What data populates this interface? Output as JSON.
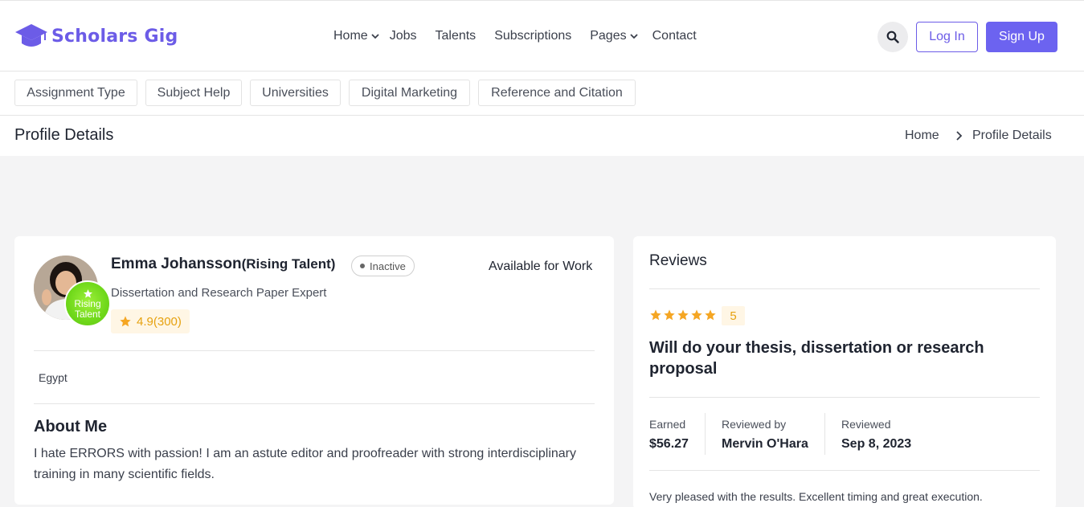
{
  "brand": {
    "name": "Scholars Gig",
    "color": "#6c5ce7"
  },
  "nav": {
    "items": [
      {
        "label": "Home",
        "dropdown": true
      },
      {
        "label": "Jobs",
        "dropdown": false
      },
      {
        "label": "Talents",
        "dropdown": false
      },
      {
        "label": "Subscriptions",
        "dropdown": false
      },
      {
        "label": "Pages",
        "dropdown": true
      },
      {
        "label": "Contact",
        "dropdown": false
      }
    ],
    "search_icon": "search-icon",
    "login_label": "Log In",
    "signup_label": "Sign Up"
  },
  "categories": [
    "Assignment Type",
    "Subject Help",
    "Universities",
    "Digital Marketing",
    "Reference and Citation"
  ],
  "page": {
    "title": "Profile Details",
    "breadcrumb": [
      "Home",
      "Profile Details"
    ]
  },
  "profile": {
    "name": "Emma Johansson",
    "name_suffix": "(Rising Talent)",
    "status": "Inactive",
    "availability": "Available for Work",
    "tagline": "Dissertation and Research Paper Expert",
    "rating": "4.9(300)",
    "badge_line1": "Rising",
    "badge_line2": "Talent",
    "location": "Egypt",
    "about_title": "About Me",
    "about_text": "I hate ERRORS with passion! I am an astute editor and proofreader with strong interdisciplinary training in many scientific fields.",
    "badge_color": "#6fd81a"
  },
  "reviews": {
    "title": "Reviews",
    "stars": 5,
    "score": "5",
    "heading": "Will do your thesis, dissertation or research proposal",
    "earned_label": "Earned",
    "earned_value": "$56.27",
    "reviewer_label": "Reviewed by",
    "reviewer_value": "Mervin O'Hara",
    "date_label": "Reviewed",
    "date_value": "Sep 8, 2023",
    "text": "Very pleased with the results. Excellent timing and great execution.",
    "star_color": "#f5a623"
  }
}
